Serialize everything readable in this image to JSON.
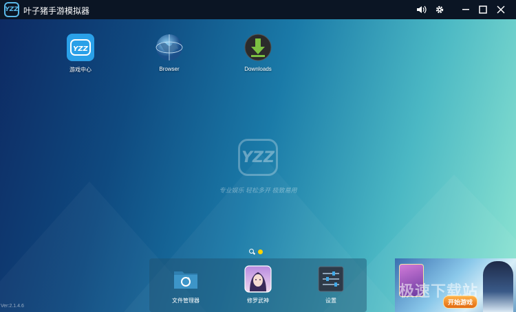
{
  "window": {
    "logo_text": "YZZ",
    "title": "叶子猪手游模拟器",
    "controls": [
      "volume-icon",
      "gear-icon",
      "minimize-icon",
      "maximize-icon",
      "close-icon"
    ]
  },
  "desktop": {
    "apps": [
      {
        "label": "游戏中心",
        "icon": "yzz-game-center-icon"
      },
      {
        "label": "Browser",
        "icon": "globe-browser-icon"
      },
      {
        "label": "Downloads",
        "icon": "download-arrow-icon"
      }
    ],
    "center_logo": "YZZ",
    "slogan": "专业娱乐  轻松多开  极致易用",
    "page_indicator": {
      "pages": 1,
      "current": 1
    }
  },
  "dock": {
    "items": [
      {
        "label": "文件管理器",
        "icon": "folder-refresh-icon"
      },
      {
        "label": "修罗武神",
        "icon": "game-avatar-icon"
      },
      {
        "label": "设置",
        "icon": "settings-sliders-icon"
      }
    ]
  },
  "version": "Ver:2.1.4.6",
  "promo": {
    "button": "开始游戏",
    "watermark": "极速下载站"
  },
  "colors": {
    "titlebar": "#0b1524",
    "accent_yellow": "#ffd400",
    "yzz_blue": "#2aa0e8",
    "download_green": "#7bc142"
  }
}
